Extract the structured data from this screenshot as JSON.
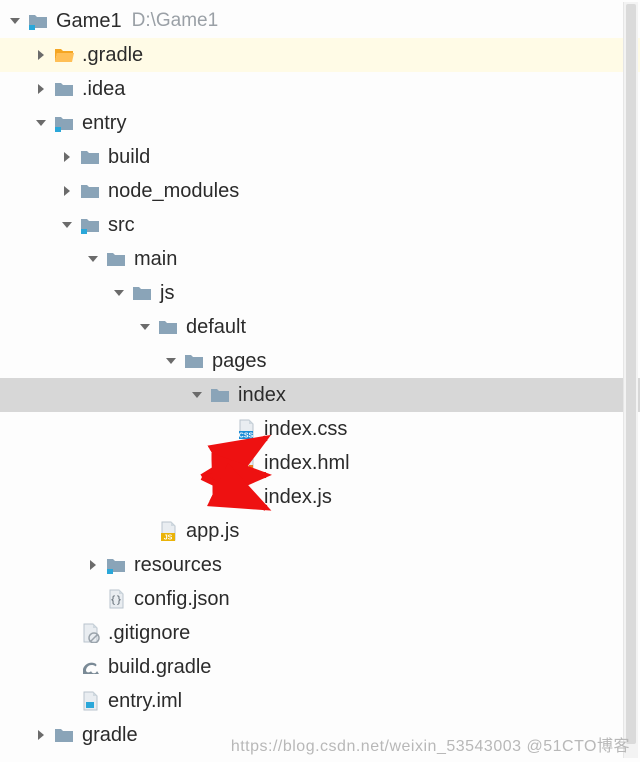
{
  "root": {
    "name": "Game1",
    "path": "D:\\Game1"
  },
  "tree": [
    {
      "indent": 0,
      "arrow": "down",
      "icon": "folder-marked",
      "label": "Game1",
      "path": "D:\\Game1",
      "sel": false,
      "hl": false
    },
    {
      "indent": 1,
      "arrow": "right",
      "icon": "folder-open-orange",
      "label": ".gradle",
      "sel": false,
      "hl": true
    },
    {
      "indent": 1,
      "arrow": "right",
      "icon": "folder",
      "label": ".idea",
      "sel": false,
      "hl": false
    },
    {
      "indent": 1,
      "arrow": "down",
      "icon": "folder-marked",
      "label": "entry",
      "sel": false,
      "hl": false
    },
    {
      "indent": 2,
      "arrow": "right",
      "icon": "folder",
      "label": "build",
      "sel": false,
      "hl": false
    },
    {
      "indent": 2,
      "arrow": "right",
      "icon": "folder",
      "label": "node_modules",
      "sel": false,
      "hl": false
    },
    {
      "indent": 2,
      "arrow": "down",
      "icon": "folder-marked",
      "label": "src",
      "sel": false,
      "hl": false
    },
    {
      "indent": 3,
      "arrow": "down",
      "icon": "folder",
      "label": "main",
      "sel": false,
      "hl": false
    },
    {
      "indent": 4,
      "arrow": "down",
      "icon": "folder",
      "label": "js",
      "sel": false,
      "hl": false
    },
    {
      "indent": 5,
      "arrow": "down",
      "icon": "folder",
      "label": "default",
      "sel": false,
      "hl": false
    },
    {
      "indent": 6,
      "arrow": "down",
      "icon": "folder",
      "label": "pages",
      "sel": false,
      "hl": false
    },
    {
      "indent": 7,
      "arrow": "down",
      "icon": "folder",
      "label": "index",
      "sel": true,
      "hl": false
    },
    {
      "indent": 8,
      "arrow": "none",
      "icon": "file-css",
      "label": "index.css",
      "sel": false,
      "hl": false
    },
    {
      "indent": 8,
      "arrow": "none",
      "icon": "file-hml",
      "label": "index.hml",
      "sel": false,
      "hl": false
    },
    {
      "indent": 8,
      "arrow": "none",
      "icon": "file-js",
      "label": "index.js",
      "sel": false,
      "hl": false
    },
    {
      "indent": 5,
      "arrow": "none",
      "icon": "file-js",
      "label": "app.js",
      "sel": false,
      "hl": false
    },
    {
      "indent": 3,
      "arrow": "right",
      "icon": "folder-marked",
      "label": "resources",
      "sel": false,
      "hl": false
    },
    {
      "indent": 3,
      "arrow": "none",
      "icon": "file-json",
      "label": "config.json",
      "sel": false,
      "hl": false
    },
    {
      "indent": 2,
      "arrow": "none",
      "icon": "file-gitignore",
      "label": ".gitignore",
      "sel": false,
      "hl": false
    },
    {
      "indent": 2,
      "arrow": "none",
      "icon": "file-gradle",
      "label": "build.gradle",
      "sel": false,
      "hl": false
    },
    {
      "indent": 2,
      "arrow": "none",
      "icon": "file-iml",
      "label": "entry.iml",
      "sel": false,
      "hl": false
    },
    {
      "indent": 1,
      "arrow": "right",
      "icon": "folder",
      "label": "gradle",
      "sel": false,
      "hl": false
    }
  ],
  "watermark": "https://blog.csdn.net/weixin_53543003   @51CTO博客"
}
